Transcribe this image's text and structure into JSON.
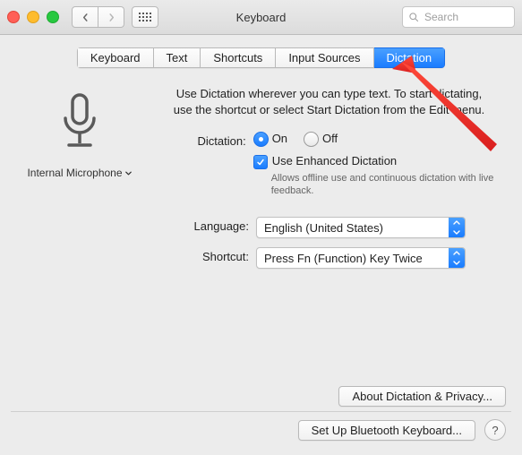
{
  "titlebar": {
    "title": "Keyboard",
    "search_placeholder": "Search"
  },
  "tabs": [
    {
      "label": "Keyboard",
      "active": false
    },
    {
      "label": "Text",
      "active": false
    },
    {
      "label": "Shortcuts",
      "active": false
    },
    {
      "label": "Input Sources",
      "active": false
    },
    {
      "label": "Dictation",
      "active": true
    }
  ],
  "mic": {
    "label": "Internal Microphone"
  },
  "intro": "Use Dictation wherever you can type text. To start dictating, use the shortcut or select Start Dictation from the Edit menu.",
  "dictation": {
    "label": "Dictation:",
    "on_label": "On",
    "off_label": "Off",
    "enhanced_label": "Use Enhanced Dictation",
    "enhanced_sub": "Allows offline use and continuous dictation with live feedback."
  },
  "language": {
    "label": "Language:",
    "value": "English (United States)"
  },
  "shortcut": {
    "label": "Shortcut:",
    "value": "Press Fn (Function) Key Twice"
  },
  "about_btn": "About Dictation & Privacy...",
  "bluetooth_btn": "Set Up Bluetooth Keyboard...",
  "help_btn": "?"
}
